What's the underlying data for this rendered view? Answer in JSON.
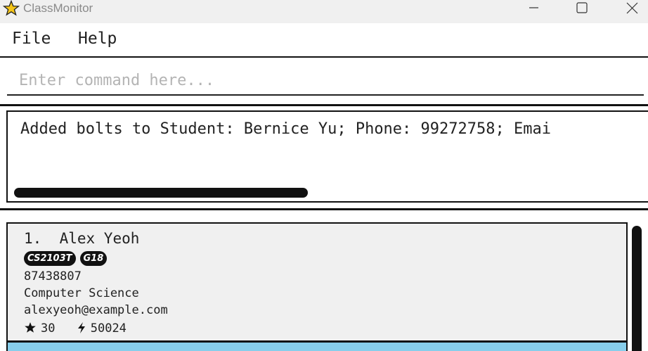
{
  "window": {
    "title": "ClassMonitor"
  },
  "menu": {
    "file_label": "File",
    "help_label": "Help"
  },
  "command": {
    "placeholder": "Enter command here...",
    "value": ""
  },
  "result": {
    "text": "Added bolts to Student: Bernice Yu; Phone: 99272758; Emai"
  },
  "students": [
    {
      "index": "1.",
      "name": "Alex Yeoh",
      "tags": [
        "CS2103T",
        "G18"
      ],
      "phone": "87438807",
      "major": "Computer Science",
      "email": "alexyeoh@example.com",
      "stars": "30",
      "bolts": "50024"
    }
  ],
  "colors": {
    "accent_selected": "#87ceeb",
    "star_icon": "#f5c518",
    "tag_bg": "#111111"
  },
  "icons": {
    "app": "star-icon",
    "star": "star-icon",
    "bolt": "bolt-icon"
  }
}
